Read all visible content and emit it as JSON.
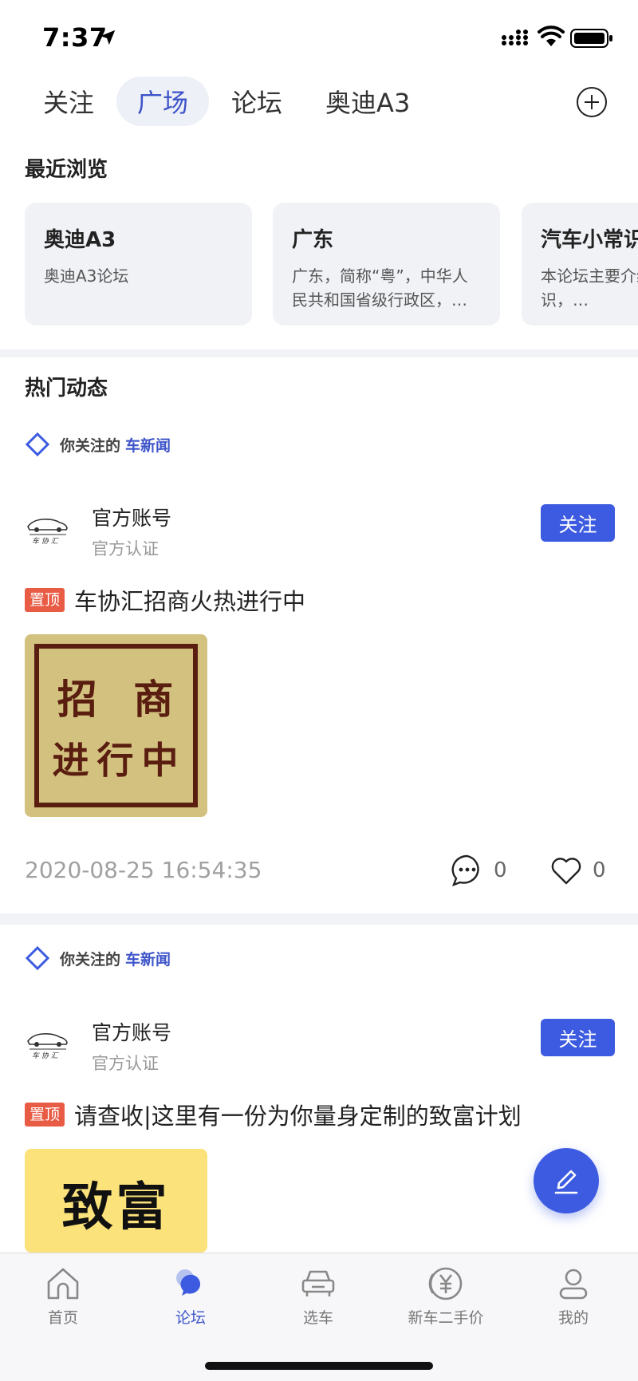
{
  "status_bar": {
    "time": "7:37"
  },
  "top_tabs": [
    {
      "label": "关注",
      "active": false
    },
    {
      "label": "广场",
      "active": true
    },
    {
      "label": "论坛",
      "active": false
    },
    {
      "label": "奥迪A3",
      "active": false
    }
  ],
  "recent": {
    "title": "最近浏览",
    "cards": [
      {
        "title": "奥迪A3",
        "desc": "奥迪A3论坛"
      },
      {
        "title": "广东",
        "desc": "广东，简称“粤”，中华人民共和国省级行政区，…"
      },
      {
        "title": "汽车小常识",
        "desc": "本论坛主要介绍车的小常识，…"
      }
    ]
  },
  "hot": {
    "title": "热门动态"
  },
  "posts": [
    {
      "follow_prefix": "你关注的",
      "follow_link": "车新闻",
      "author_name": "官方账号",
      "author_verify": "官方认证",
      "follow_button": "关注",
      "pin_label": "置顶",
      "title": "车协汇招商火热进行中",
      "image_text_line1": "招 商",
      "image_text_line2": "进行中",
      "time": "2020-08-25 16:54:35",
      "comments": "0",
      "likes": "0"
    },
    {
      "follow_prefix": "你关注的",
      "follow_link": "车新闻",
      "author_name": "官方账号",
      "author_verify": "官方认证",
      "follow_button": "关注",
      "pin_label": "置顶",
      "title": "请查收|这里有一份为你量身定制的致富计划",
      "image_text": "致富"
    }
  ],
  "bottom_nav": [
    {
      "label": "首页",
      "icon": "home-icon",
      "active": false
    },
    {
      "label": "论坛",
      "icon": "forum-icon",
      "active": true
    },
    {
      "label": "选车",
      "icon": "car-icon",
      "active": false
    },
    {
      "label": "新车二手价",
      "icon": "price-icon",
      "active": false
    },
    {
      "label": "我的",
      "icon": "profile-icon",
      "active": false
    }
  ],
  "colors": {
    "accent": "#3d5be0",
    "pin": "#e85b44",
    "tab_active_bg": "#eef0f7"
  }
}
